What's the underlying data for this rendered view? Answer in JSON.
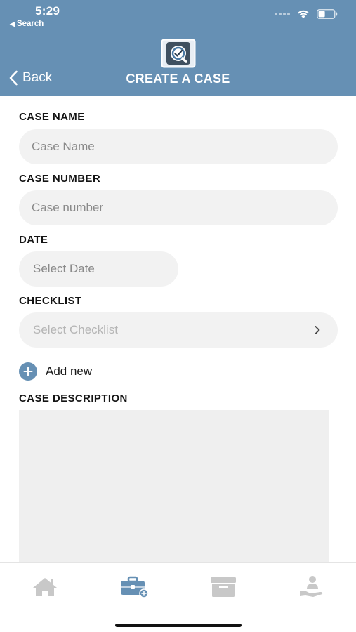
{
  "status_bar": {
    "time": "5:29",
    "back_app": "Search"
  },
  "nav": {
    "back_label": "Back",
    "title": "CREATE A CASE"
  },
  "form": {
    "case_name": {
      "label": "CASE NAME",
      "placeholder": "Case Name",
      "value": ""
    },
    "case_number": {
      "label": "CASE NUMBER",
      "placeholder": "Case number",
      "value": ""
    },
    "date": {
      "label": "DATE",
      "placeholder": "Select Date"
    },
    "checklist": {
      "label": "CHECKLIST",
      "placeholder": "Select Checklist"
    },
    "add_new_label": "Add new",
    "description": {
      "label": "CASE DESCRIPTION",
      "value": ""
    }
  },
  "tabs": [
    {
      "icon": "home-icon",
      "active": false
    },
    {
      "icon": "briefcase-add-icon",
      "active": true
    },
    {
      "icon": "archive-icon",
      "active": false
    },
    {
      "icon": "person-hand-icon",
      "active": false
    }
  ],
  "colors": {
    "primary": "#6690b4",
    "tab_inactive": "#c8c8c8",
    "field_bg": "#f2f2f2"
  }
}
